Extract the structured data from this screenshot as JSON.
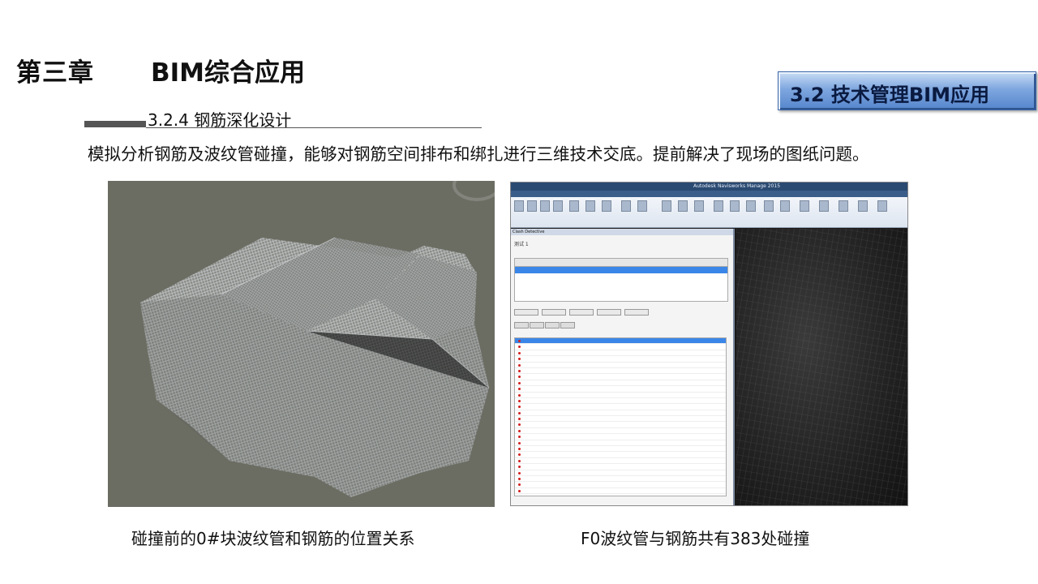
{
  "header": {
    "chapter": "第三章",
    "chapter_title": "BIM综合应用",
    "section_badge": "3.2 技术管理BIM应用"
  },
  "subsection": {
    "title": "3.2.4 钢筋深化设计"
  },
  "body": {
    "paragraph": "模拟分析钢筋及波纹管碰撞，能够对钢筋空间排布和绑扎进行三维技术交底。提前解决了现场的图纸问题。"
  },
  "figures": {
    "left_caption": "碰撞前的0#块波纹管和钢筋的位置关系",
    "right_caption": "F0波纹管与钢筋共有383处碰撞",
    "right_window_title": "Autodesk Navisworks Manage 2015",
    "right_panel_title": "Clash Detective",
    "right_test_name": "测试 1"
  },
  "colors": {
    "badge_fill": "#7fa7df",
    "selection_blue": "#3a86e8",
    "clash_dot": "#d21e1e",
    "left_image_bg": "#6b6d63"
  }
}
